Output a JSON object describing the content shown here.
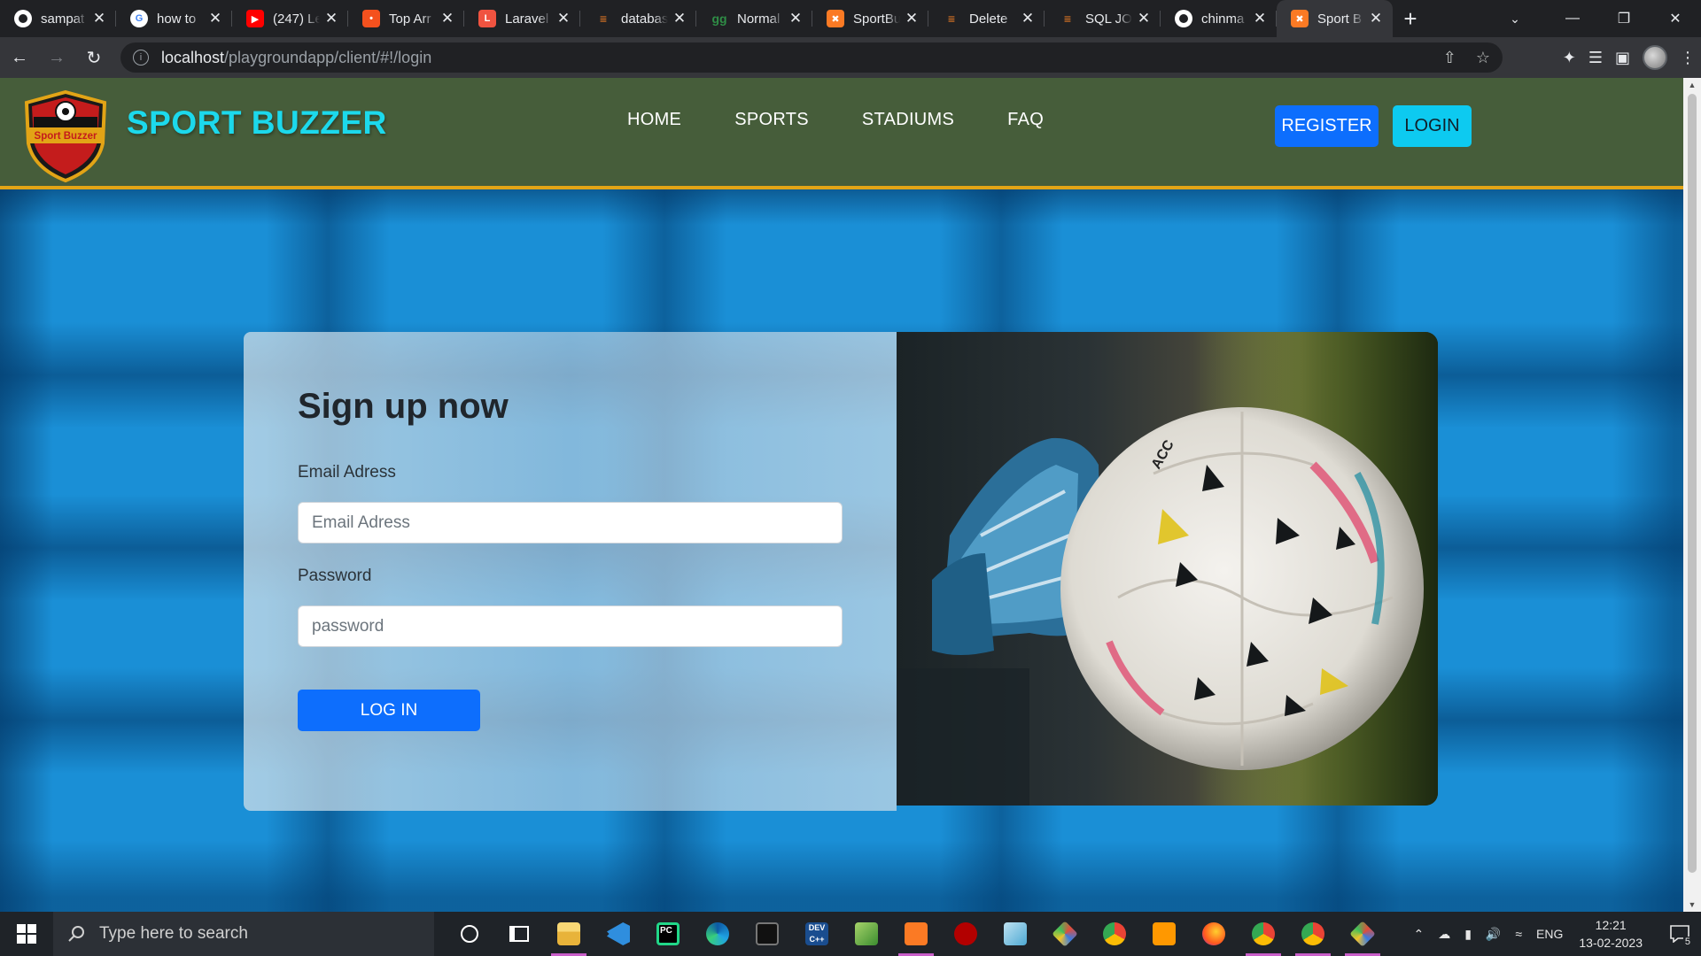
{
  "browser": {
    "tabs": [
      {
        "title": "sampat",
        "favicon": "github-icon",
        "color": "#ffffff"
      },
      {
        "title": "how to",
        "favicon": "google-icon",
        "color": "#4285f4"
      },
      {
        "title": "(247) Le",
        "favicon": "youtube-icon",
        "color": "#ff0000"
      },
      {
        "title": "Top Arr",
        "favicon": "codepen-icon",
        "color": "#f4511e"
      },
      {
        "title": "Laravel",
        "favicon": "laravel-icon",
        "color": "#f05340"
      },
      {
        "title": "databas",
        "favicon": "stackoverflow-icon",
        "color": "#f48024"
      },
      {
        "title": "Normal",
        "favicon": "geeksforgeeks-icon",
        "color": "#2f8d46"
      },
      {
        "title": "SportBu",
        "favicon": "xampp-icon",
        "color": "#fb7a24"
      },
      {
        "title": "Delete",
        "favicon": "stackoverflow-icon",
        "color": "#f48024"
      },
      {
        "title": "SQL JO",
        "favicon": "stackoverflow-icon",
        "color": "#f48024"
      },
      {
        "title": "chinma",
        "favicon": "github-icon",
        "color": "#ffffff"
      },
      {
        "title": "Sport B",
        "favicon": "xampp-icon",
        "color": "#fb7a24",
        "active": true
      }
    ],
    "url_host": "localhost",
    "url_path": "/playgroundapp/client/#!/login"
  },
  "site": {
    "brand": "SPORT BUZZER",
    "logo_text": "Sport Buzzer",
    "nav": [
      "HOME",
      "SPORTS",
      "STADIUMS",
      "FAQ"
    ],
    "register_label": "REGISTER",
    "login_label": "LOGIN",
    "colors": {
      "header": "#465d3a",
      "brand": "#1cd9ec",
      "accent_line": "#e2a416",
      "primary": "#0d6efd",
      "info": "#0dcaf0"
    }
  },
  "form": {
    "title": "Sign up now",
    "email_label": "Email Adress",
    "email_placeholder": "Email Adress",
    "password_label": "Password",
    "password_placeholder": "password",
    "submit_label": "LOG IN"
  },
  "taskbar": {
    "search_placeholder": "Type here to search",
    "language": "ENG",
    "time": "12:21",
    "date": "13-02-2023",
    "notification_count": "5"
  }
}
